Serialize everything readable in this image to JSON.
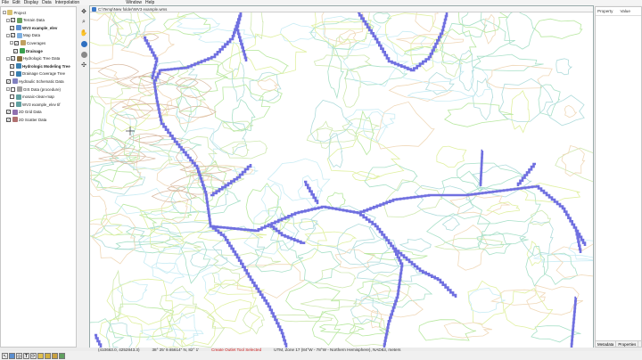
{
  "menu": [
    "File",
    "Edit",
    "Display",
    "Data",
    "Interpolation",
    "Window",
    "Help"
  ],
  "tree": [
    {
      "label": "Project",
      "indent": 0,
      "check": false,
      "expander": "-",
      "icon": "folder-icon",
      "color": "#d8c070"
    },
    {
      "label": "Terrain Data",
      "indent": 1,
      "check": true,
      "expander": "-",
      "icon": "terrain-icon",
      "color": "#6aa060"
    },
    {
      "label": "WV3 example_elev",
      "indent": 2,
      "check": true,
      "expander": "",
      "icon": "tin-icon",
      "color": "#5a8fd0",
      "bold": true
    },
    {
      "label": "Map Data",
      "indent": 1,
      "check": true,
      "expander": "-",
      "icon": "map-icon",
      "color": "#7fb0e0"
    },
    {
      "label": "Coverages",
      "indent": 2,
      "check": true,
      "expander": "-",
      "icon": "coverage-icon",
      "color": "#c0a060"
    },
    {
      "label": "Drainage",
      "indent": 3,
      "check": true,
      "expander": "",
      "icon": "drainage-icon",
      "color": "#3aa050",
      "bold": true
    },
    {
      "label": "Hydrologic Tree Data",
      "indent": 1,
      "check": true,
      "expander": "-",
      "icon": "tree-icon",
      "color": "#8a7040"
    },
    {
      "label": "Hydrologic Modeling Tree",
      "indent": 2,
      "check": true,
      "expander": "",
      "icon": "tree-icon",
      "color": "#3a80b0",
      "bold": true
    },
    {
      "label": "Drainage Coverage Tree",
      "indent": 2,
      "check": false,
      "expander": "",
      "icon": "tree-icon",
      "color": "#3a80b0"
    },
    {
      "label": "Hydraulic Schematic Data",
      "indent": 1,
      "check": true,
      "expander": "",
      "icon": "schematic-icon",
      "color": "#8080c0"
    },
    {
      "label": "GIS Data (procedure)",
      "indent": 1,
      "check": false,
      "expander": "-",
      "icon": "gis-icon",
      "color": "#a0a0a0"
    },
    {
      "label": "mosaic-clean-map",
      "indent": 2,
      "check": false,
      "expander": "",
      "icon": "raster-icon",
      "color": "#60a0a0"
    },
    {
      "label": "WV3 example_elev tif",
      "indent": 2,
      "check": false,
      "expander": "",
      "icon": "raster-icon",
      "color": "#60a0a0"
    },
    {
      "label": "2D Grid Data",
      "indent": 1,
      "check": true,
      "expander": "",
      "icon": "grid-icon",
      "color": "#9070b0"
    },
    {
      "label": "2D Scatter Data",
      "indent": 1,
      "check": true,
      "expander": "",
      "icon": "scatter-icon",
      "color": "#b07070"
    }
  ],
  "map": {
    "title": "C:\\Temp\\New folder\\WV3 example.wms",
    "stream_color": "#7070e0"
  },
  "properties": {
    "col1": "Property",
    "col2": "Value",
    "tab1": "Metadata",
    "tab2": "Properties"
  },
  "status": {
    "coords": "(410663.0, 4252843.3)",
    "latlon": "38° 25' 9.65614\" N, 82° 1'",
    "message": "Create Outlet Tool Selected",
    "projection": "UTM, Zone 17 (84°W - 78°W - Northern Hemisphere), NAD83, meters"
  },
  "bottom_tools": [
    "select-icon",
    "frame-icon",
    "zoom-icon",
    "text-icon",
    "rotate-icon",
    "paint-icon",
    "layers-icon",
    "grid-icon",
    "marker-icon"
  ]
}
